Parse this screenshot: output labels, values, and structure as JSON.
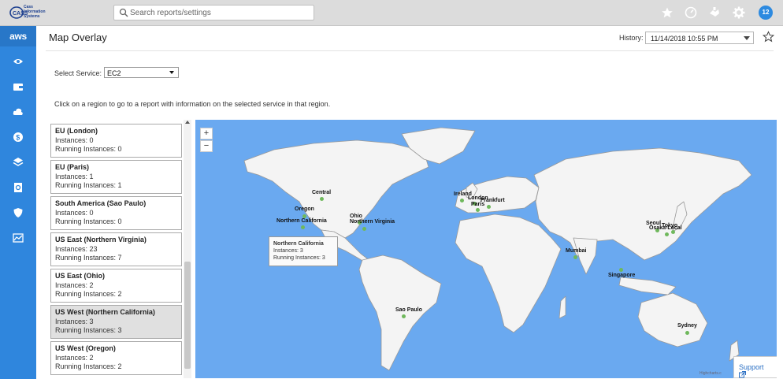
{
  "topbar": {
    "logo_text": "Cass Information Systems",
    "search_placeholder": "Search reports/settings",
    "notification_count": "12",
    "icons": [
      "star-icon",
      "speedometer-icon",
      "handshake-icon",
      "gear-icon"
    ]
  },
  "sidebar": {
    "aws_label": "aws",
    "items": [
      "eye-icon",
      "wallet-icon",
      "cloud-icon",
      "dollar-icon",
      "layers-icon",
      "report-icon",
      "shield-icon",
      "chart-icon"
    ]
  },
  "header": {
    "title": "Map Overlay",
    "history_label": "History:",
    "history_value": "11/14/2018 10:55 PM"
  },
  "service": {
    "label": "Select Service:",
    "value": "EC2"
  },
  "instructions": "Click on a region to go to a report with information on the selected service in that region.",
  "regions": [
    {
      "name": "EU (London)",
      "instances": "Instances: 0",
      "running": "Running Instances: 0"
    },
    {
      "name": "EU (Paris)",
      "instances": "Instances: 1",
      "running": "Running Instances: 1"
    },
    {
      "name": "South America (Sao Paulo)",
      "instances": "Instances: 0",
      "running": "Running Instances: 0"
    },
    {
      "name": "US East (Northern Virginia)",
      "instances": "Instances: 23",
      "running": "Running Instances: 7"
    },
    {
      "name": "US East (Ohio)",
      "instances": "Instances: 2",
      "running": "Running Instances: 2"
    },
    {
      "name": "US West (Northern California)",
      "instances": "Instances: 3",
      "running": "Running Instances: 3"
    },
    {
      "name": "US West (Oregon)",
      "instances": "Instances: 2",
      "running": "Running Instances: 2"
    }
  ],
  "map": {
    "zoom_in": "+",
    "zoom_out": "−",
    "labels": [
      "Central",
      "Oregon",
      "Ohio",
      "Northern California",
      "Northern Virginia",
      "Ireland",
      "London",
      "Frankfurt",
      "Paris",
      "Mumbai",
      "Seoul",
      "Tokyo",
      "Osaka-Local",
      "Singapore",
      "Sao Paulo",
      "Sydney"
    ],
    "tooltip": {
      "title": "Northern California",
      "instances": "Instances: 3",
      "running": "Running Instances: 3"
    },
    "credit": "Highcharts.c",
    "support": "Support"
  },
  "colors": {
    "sidebar": "#2f86dd",
    "ocean": "#6aa9f0",
    "land": "#f4f4f4",
    "marker": "#6fb85c"
  }
}
